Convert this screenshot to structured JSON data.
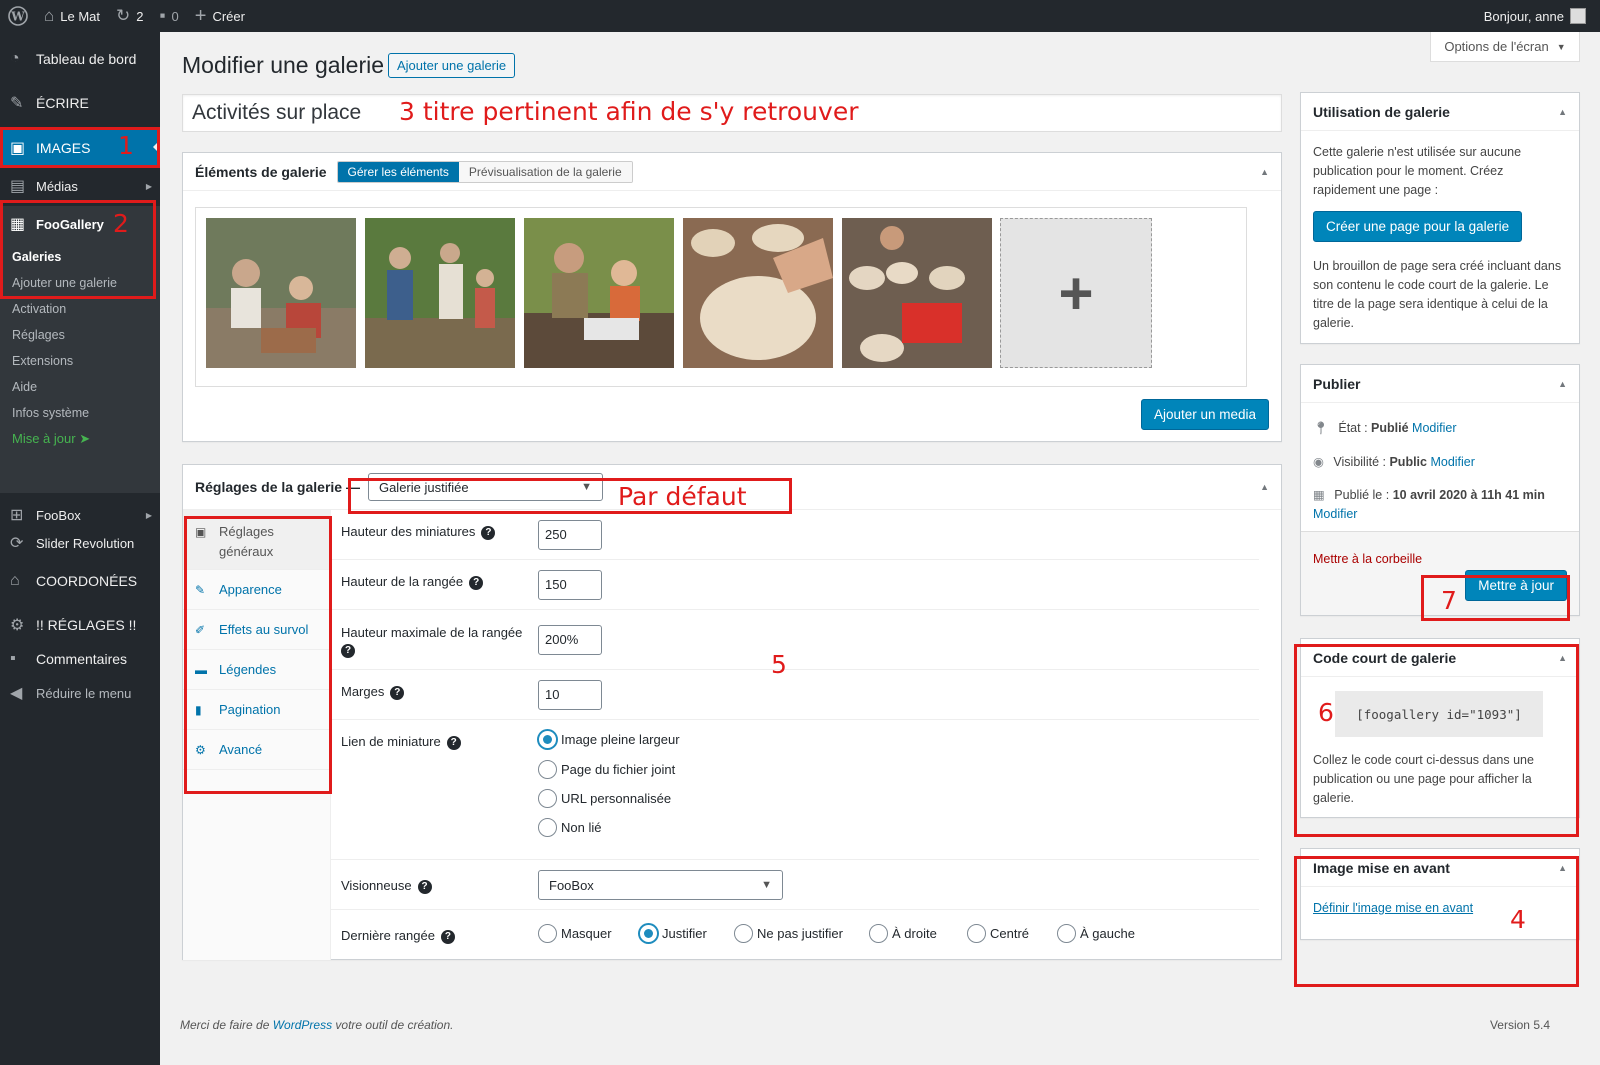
{
  "adminbar": {
    "site_name": "Le Mat",
    "updates_count": "2",
    "comments_count": "0",
    "create_label": "Créer",
    "greeting": "Bonjour, anne"
  },
  "sidebar": {
    "dashboard": "Tableau de bord",
    "write": "ÉCRIRE",
    "images": "IMAGES",
    "media": "Médias",
    "foogallery": "FooGallery",
    "sub": {
      "galleries": "Galeries",
      "add_gallery": "Ajouter une galerie",
      "activation": "Activation",
      "settings": "Réglages",
      "extensions": "Extensions",
      "help": "Aide",
      "system_info": "Infos système",
      "update": "Mise à jour"
    },
    "foobox": "FooBox",
    "slider": "Slider Revolution",
    "contact": "COORDONÉES",
    "main_settings": "!! RÉGLAGES !!",
    "comments": "Commentaires",
    "collapse": "Réduire le menu"
  },
  "page": {
    "title": "Modifier une galerie",
    "add_button": "Ajouter une galerie",
    "screen_options": "Options de l'écran",
    "gallery_title_value": "Activités sur place"
  },
  "annotations": {
    "a1": "1",
    "a2": "2",
    "a3": "3 titre pertinent afin de s'y retrouver",
    "a4": "4",
    "a5": "5",
    "a6": "6",
    "a7": "7",
    "default": "Par défaut"
  },
  "elements_box": {
    "title": "Éléments de galerie",
    "tab_manage": "Gérer les éléments",
    "tab_preview": "Prévisualisation de la galerie",
    "add_media": "Ajouter un media",
    "add_tile": "+"
  },
  "settings_box": {
    "title": "Réglages de la galerie —",
    "template": "Galerie justifiée",
    "tabs": [
      "Réglages généraux",
      "Apparence",
      "Effets au survol",
      "Légendes",
      "Pagination",
      "Avancé"
    ],
    "thumb_height_label": "Hauteur des miniatures",
    "thumb_height": "250",
    "row_height_label": "Hauteur de la rangée",
    "row_height": "150",
    "max_row_height_label": "Hauteur maximale de la rangée",
    "max_row_height": "200%",
    "margins_label": "Marges",
    "margins": "10",
    "thumb_link_label": "Lien de miniature",
    "thumb_link_options": [
      "Image pleine largeur",
      "Page du fichier joint",
      "URL personnalisée",
      "Non lié"
    ],
    "lightbox_label": "Visionneuse",
    "lightbox": "FooBox",
    "last_row_label": "Dernière rangée",
    "last_row_options": [
      "Masquer",
      "Justifier",
      "Ne pas justifier",
      "À droite",
      "Centré",
      "À gauche"
    ]
  },
  "usage_box": {
    "title": "Utilisation de galerie",
    "text1": "Cette galerie n'est utilisée sur aucune publication pour le moment. Créez rapidement une page :",
    "button": "Créer une page pour la galerie",
    "text2": "Un brouillon de page sera créé incluant dans son contenu le code court de la galerie. Le titre de la page sera identique à celui de la galerie."
  },
  "publish_box": {
    "title": "Publier",
    "state_label": "État :",
    "state_value": "Publié",
    "visibility_label": "Visibilité :",
    "visibility_value": "Public",
    "published_label": "Publié le :",
    "published_value": "10 avril 2020 à 11h 41 min",
    "edit": "Modifier",
    "trash": "Mettre à la corbeille",
    "update": "Mettre à jour"
  },
  "shortcode_box": {
    "title": "Code court de galerie",
    "code": "[foogallery id=\"1093\"]",
    "text": "Collez le code court ci-dessus dans une publication ou une page pour afficher la galerie."
  },
  "featured_box": {
    "title": "Image mise en avant",
    "link": "Définir l'image mise en avant"
  },
  "footer": {
    "prefix": "Merci de faire de",
    "link": "WordPress",
    "suffix": "votre outil de création.",
    "version": "Version 5.4"
  }
}
